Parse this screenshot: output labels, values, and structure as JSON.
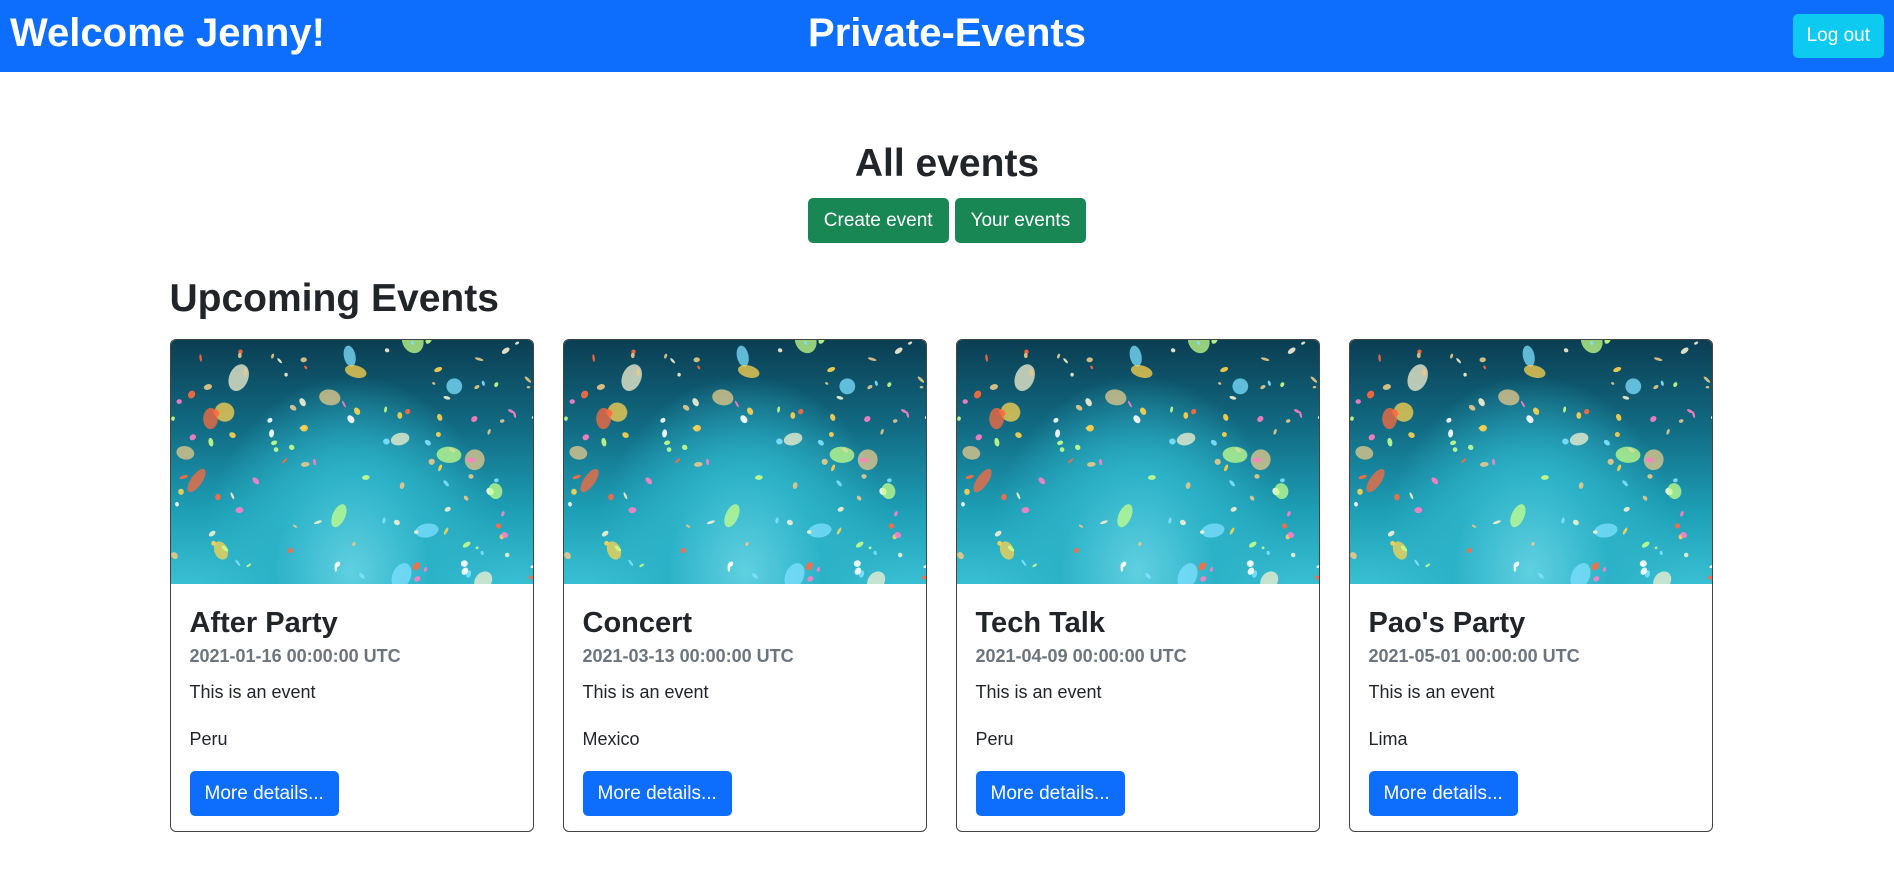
{
  "navbar": {
    "welcome_text": "Welcome Jenny!",
    "brand": "Private-Events",
    "logout_label": "Log out"
  },
  "header": {
    "title": "All events",
    "create_label": "Create event",
    "your_events_label": "Your events"
  },
  "section": {
    "title": "Upcoming Events"
  },
  "events": [
    {
      "title": "After Party",
      "date": "2021-01-16 00:00:00 UTC",
      "description": "This is an event",
      "location": "Peru",
      "button_label": "More details..."
    },
    {
      "title": "Concert",
      "date": "2021-03-13 00:00:00 UTC",
      "description": "This is an event",
      "location": "Mexico",
      "button_label": "More details..."
    },
    {
      "title": "Tech Talk",
      "date": "2021-04-09 00:00:00 UTC",
      "description": "This is an event",
      "location": "Peru",
      "button_label": "More details..."
    },
    {
      "title": "Pao's Party",
      "date": "2021-05-01 00:00:00 UTC",
      "description": "This is an event",
      "location": "Lima",
      "button_label": "More details..."
    }
  ],
  "colors": {
    "primary": "#0d6efd",
    "success": "#198754",
    "info": "#0dcaf0",
    "muted": "#6c757d"
  }
}
